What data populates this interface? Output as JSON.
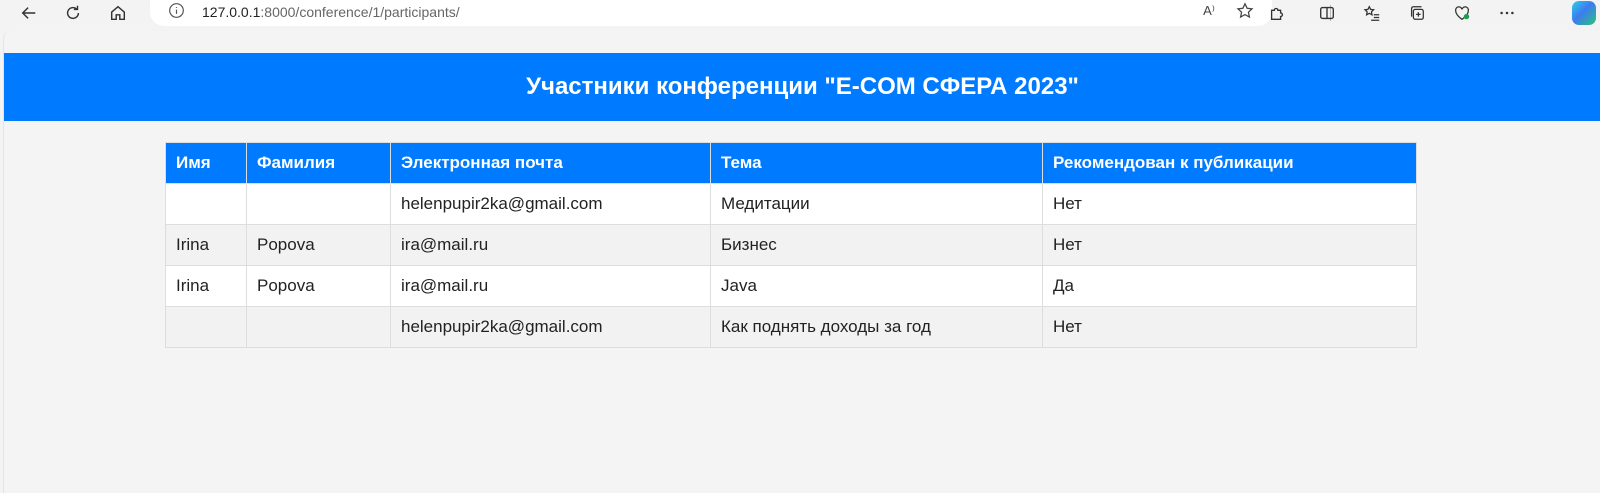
{
  "browser": {
    "url_host": "127.0.0.1",
    "url_rest": ":8000/conference/1/participants/",
    "read_aloud_label": "A⁾"
  },
  "page": {
    "title": "Участники конференции \"E-COM СФЕРА 2023\""
  },
  "table": {
    "columns": [
      "Имя",
      "Фамилия",
      "Электронная почта",
      "Тема",
      "Рекомендован к публикации"
    ],
    "rows": [
      {
        "first_name": "",
        "last_name": "",
        "email": "helenpupir2ka@gmail.com",
        "topic": "Медитации",
        "recommended": "Нет"
      },
      {
        "first_name": "Irina",
        "last_name": "Popova",
        "email": "ira@mail.ru",
        "topic": "Бизнес",
        "recommended": "Нет"
      },
      {
        "first_name": "Irina",
        "last_name": "Popova",
        "email": "ira@mail.ru",
        "topic": "Java",
        "recommended": "Да"
      },
      {
        "first_name": "",
        "last_name": "",
        "email": "helenpupir2ka@gmail.com",
        "topic": "Как поднять доходы за год",
        "recommended": "Нет"
      }
    ]
  },
  "colors": {
    "accent": "#007bff",
    "page_bg": "#f4f4f4",
    "row_alt": "#f2f2f2"
  }
}
